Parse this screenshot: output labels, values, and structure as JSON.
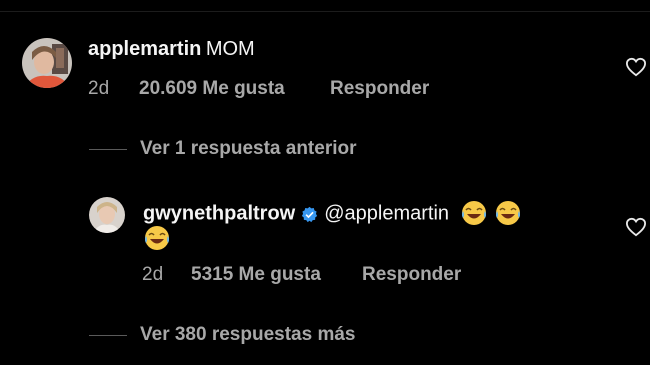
{
  "comments": [
    {
      "username": "applemartin",
      "text": "MOM",
      "time": "2d",
      "likes": "20.609 Me gusta",
      "reply_label": "Responder",
      "avatar_icon": "profile-photo"
    },
    {
      "username": "gwynethpaltrow",
      "verified": true,
      "mention": "@applemartin",
      "emojis": [
        "😂",
        "😂",
        "😂"
      ],
      "time": "2d",
      "likes": "5315 Me gusta",
      "reply_label": "Responder",
      "avatar_icon": "profile-photo"
    }
  ],
  "view_previous_replies": "Ver 1 respuesta anterior",
  "view_more_replies": "Ver 380 respuestas más",
  "icons": {
    "like": "heart-icon",
    "verified": "verified-badge-icon"
  },
  "colors": {
    "background": "#000000",
    "text": "#f5f5f5",
    "secondary": "#a8a8a8",
    "verified": "#3797f0"
  }
}
